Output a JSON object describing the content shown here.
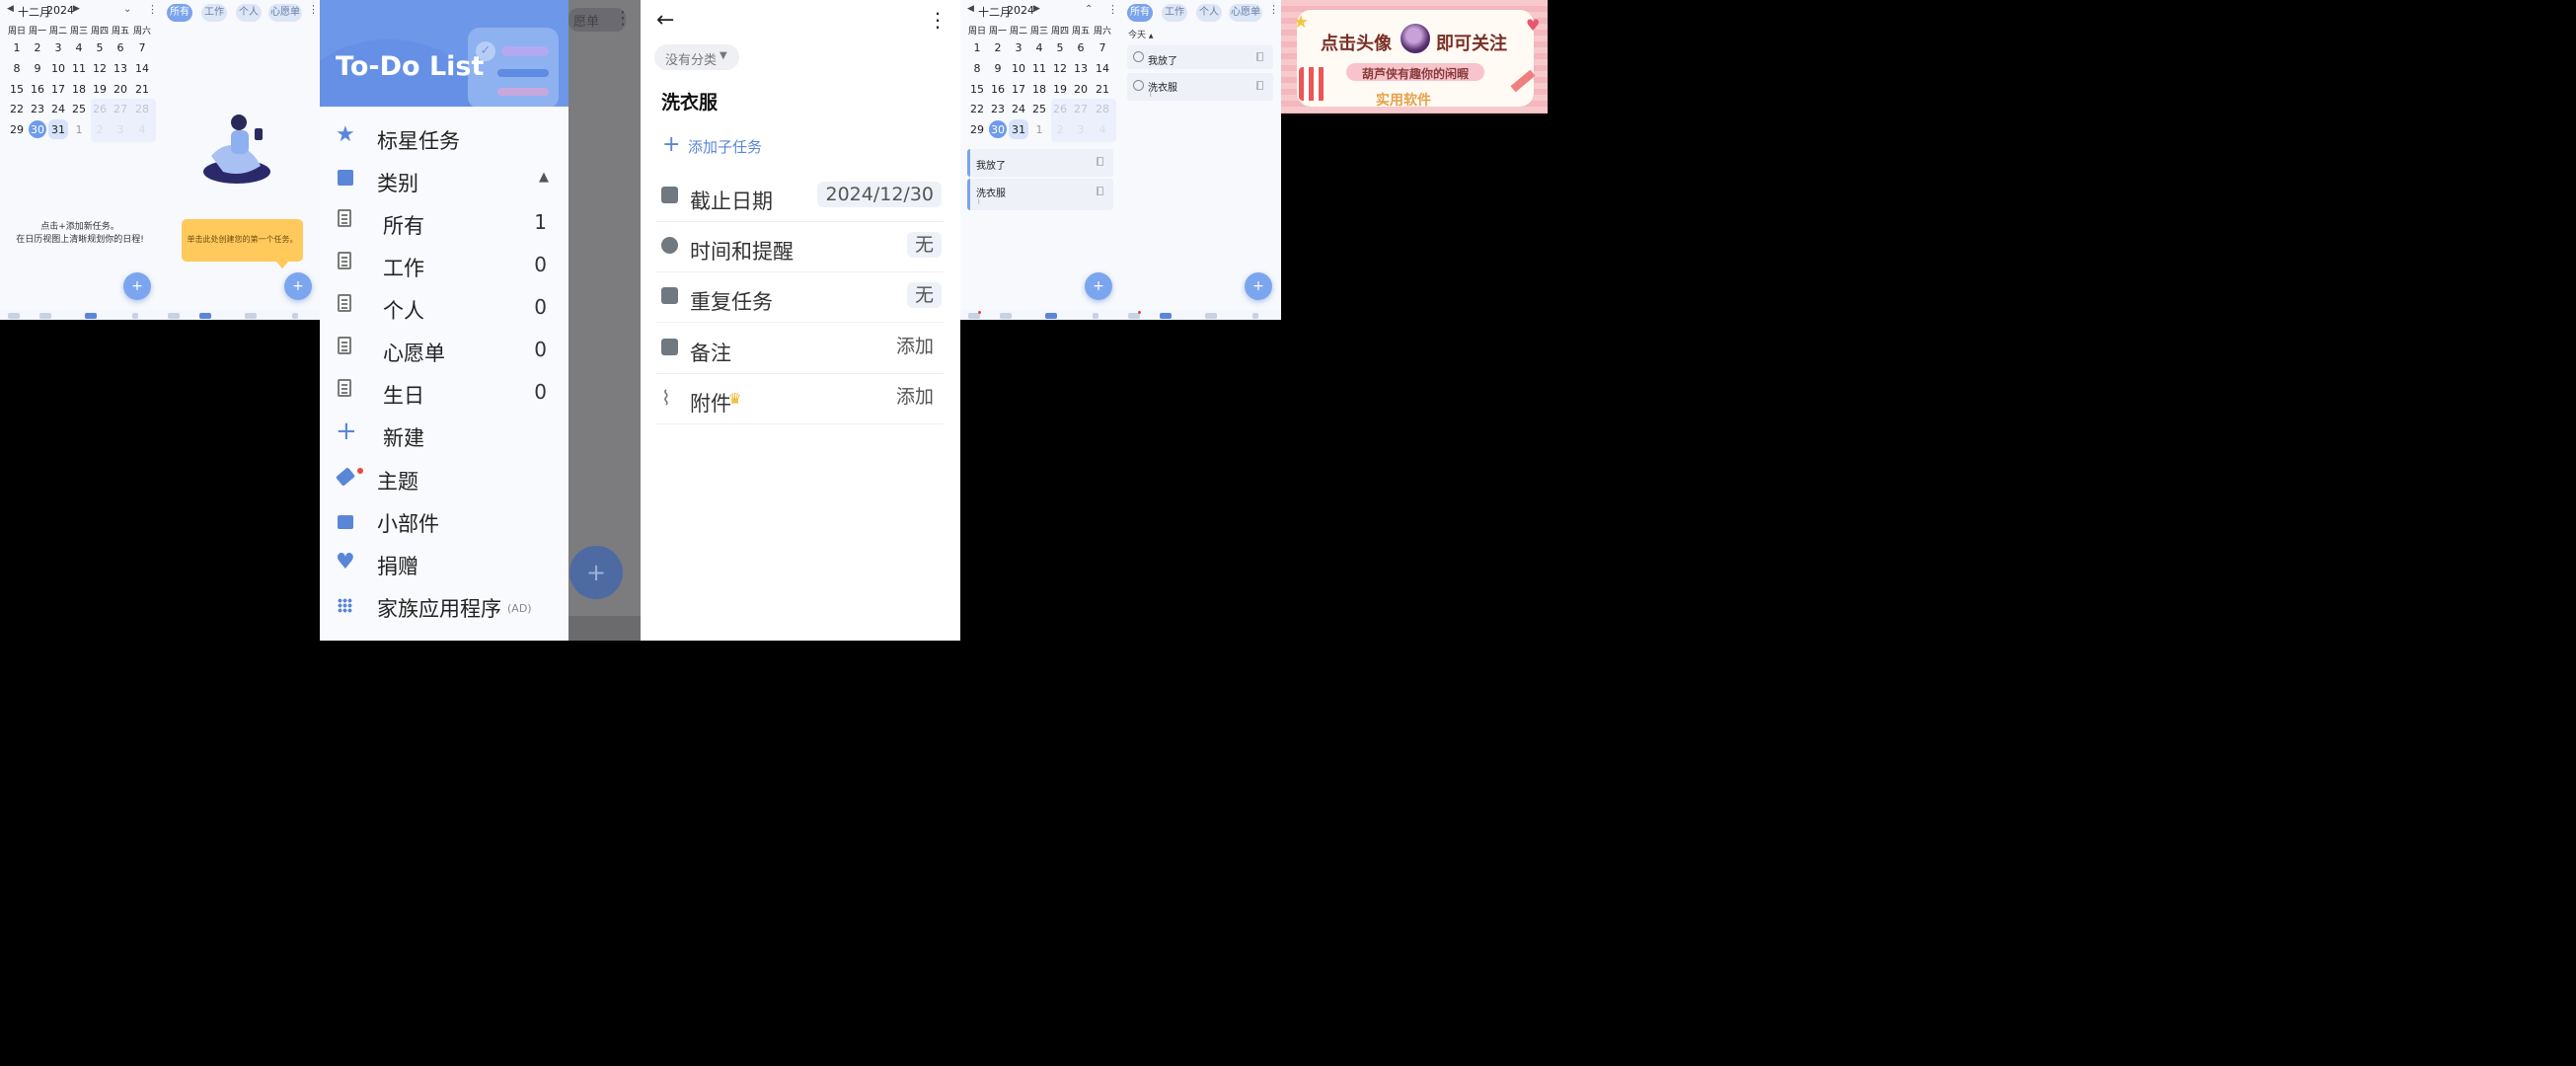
{
  "p1": {
    "month": "十二月",
    "year": "2024",
    "weekdays": [
      "周日",
      "周一",
      "周二",
      "周三",
      "周四",
      "周五",
      "周六"
    ],
    "weeks": [
      [
        "1",
        "2",
        "3",
        "4",
        "5",
        "6",
        "7"
      ],
      [
        "8",
        "9",
        "10",
        "11",
        "12",
        "13",
        "14"
      ],
      [
        "15",
        "16",
        "17",
        "18",
        "19",
        "20",
        "21"
      ],
      [
        "22",
        "23",
        "24",
        "25",
        "26",
        "27",
        "28"
      ],
      [
        "29",
        "30",
        "31",
        "1",
        "2",
        "3",
        "4"
      ]
    ],
    "selected": "30",
    "today": "31",
    "hint_line1": "点击+添加新任务。",
    "hint_line2": "在日历视图上清晰规划你的日程!"
  },
  "p2": {
    "chips": [
      "所有",
      "工作",
      "个人",
      "心愿单"
    ],
    "tooltip": "单击此处创建您的第一个任务。"
  },
  "drawer": {
    "logo": "To-Do List",
    "starred": "标星任务",
    "category": "类别",
    "categories": [
      {
        "label": "所有",
        "count": "1"
      },
      {
        "label": "工作",
        "count": "0"
      },
      {
        "label": "个人",
        "count": "0"
      },
      {
        "label": "心愿单",
        "count": "0"
      },
      {
        "label": "生日",
        "count": "0"
      }
    ],
    "new": "新建",
    "theme": "主题",
    "widgets": "小部件",
    "donate": "捐赠",
    "family_apps": "家族应用程序",
    "family_ad": "(AD)",
    "behind_tab": "愿单"
  },
  "detail": {
    "category": "没有分类",
    "title": "洗衣服",
    "add_subtask": "添加子任务",
    "rows": [
      {
        "label": "截止日期",
        "value": "2024/12/30"
      },
      {
        "label": "时间和提醒",
        "value": "无"
      },
      {
        "label": "重复任务",
        "value": "无"
      },
      {
        "label": "备注",
        "value": "添加"
      },
      {
        "label": "附件",
        "value": "添加"
      }
    ]
  },
  "p5": {
    "month": "十二月",
    "year": "2024",
    "tasks": [
      "我放了",
      "洗衣服"
    ]
  },
  "p6": {
    "chips": [
      "所有",
      "工作",
      "个人",
      "心愿单"
    ],
    "section": "今天",
    "tasks": [
      "我放了",
      "洗衣服"
    ]
  },
  "banner": {
    "line1a": "点击头像",
    "line1b": "即可关注",
    "line2": "葫芦侠有趣你的闲暇",
    "line3": "实用软件"
  },
  "colors": {
    "accent": "#6f9be9",
    "header": "#6d97e8",
    "tooltip": "#ffc95b"
  }
}
